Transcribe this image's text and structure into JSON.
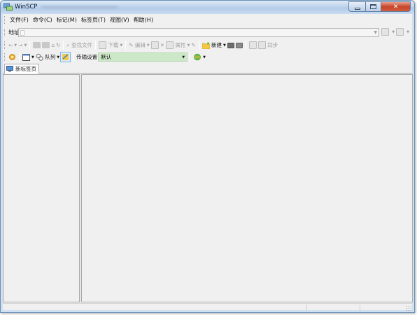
{
  "window": {
    "title": "WinSCP"
  },
  "menu": {
    "items": [
      "文件(F)",
      "命令(C)",
      "标记(M)",
      "标签页(T)",
      "视图(V)",
      "帮助(H)"
    ]
  },
  "address": {
    "label": "地址",
    "value": ""
  },
  "toolbar1": {
    "find_files": "查找文件",
    "download": "下载",
    "edit": "编辑",
    "properties": "属性",
    "new": "新建",
    "sync": "同步"
  },
  "toolbar2": {
    "queue": "队列",
    "transfer_settings": "传输设置",
    "transfer_preset": "默认"
  },
  "tabs": [
    {
      "label": "新标签页"
    }
  ],
  "colors": {
    "transfer_bg": "#cde8c8",
    "title_gradient": "#bfd3ec",
    "close_button": "#c7452b"
  }
}
